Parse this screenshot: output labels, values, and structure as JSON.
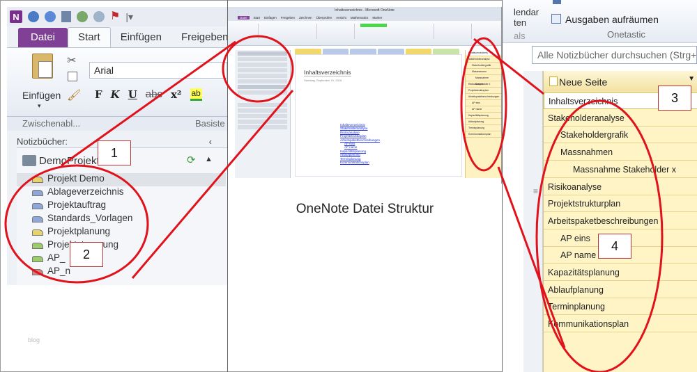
{
  "left": {
    "tabs": [
      "Datei",
      "Start",
      "Einfügen",
      "Freigeben"
    ],
    "font_name": "Arial",
    "paste_label": "Einfügen",
    "group_clipboard": "Zwischenabl...",
    "group_basic": "Basiste",
    "format_buttons": [
      "F",
      "K",
      "U",
      "abc",
      "x²",
      "ab"
    ],
    "notebooks_label": "Notizbücher:",
    "notebook_name": "DemoProjekt",
    "sections": [
      {
        "label": "Projekt Demo",
        "color": "#e8d36a",
        "selected": true
      },
      {
        "label": "Ablageverzeichnis",
        "color": "#8ea7d8",
        "selected": false
      },
      {
        "label": "Projektauftrag",
        "color": "#8ea7d8",
        "selected": false
      },
      {
        "label": "Standards_Vorlagen",
        "color": "#8ea7d8",
        "selected": false
      },
      {
        "label": "Projektplanung",
        "color": "#e8d36a",
        "selected": false
      },
      {
        "label": "Projektsteuerung",
        "color": "#9ccc6a",
        "selected": false
      },
      {
        "label": "AP_",
        "color": "#9ccc6a",
        "selected": false
      },
      {
        "label": "AP_n",
        "color": "#d98080",
        "selected": false
      }
    ]
  },
  "middle": {
    "window_title": "Inhaltsverzeichnis - Microsoft OneNote",
    "ribbon_tabs": [
      "Datei",
      "Start",
      "Einfügen",
      "Freigeben",
      "Zeichnen",
      "Überprüfen",
      "Ansicht",
      "Mathematics",
      "Marker"
    ],
    "page_title": "Inhaltsverzeichnis",
    "page_date": "Samstag, September 10, 2016",
    "page_links": [
      "Inhaltsverzeichnis",
      "Stakeholderanalyse",
      "Risikoanalyse",
      "Projektstrukturplan",
      "Arbeitspaketbeschreibungen",
      "AP eins",
      "AP name",
      "Kapazitätsplanung",
      "Ablaufplanung",
      "Terminplanung",
      "Kommunikationsplan"
    ],
    "caption": "OneNote Datei Struktur"
  },
  "right": {
    "ribbon_labels": [
      "lendar",
      "ten"
    ],
    "ribbon_label_grey": "als",
    "cleanup_button": "Ausgaben aufräumen",
    "group_name": "Onetastic",
    "search_placeholder": "Alle Notizbücher durchsuchen (Strg+E)",
    "new_page": "Neue Seite",
    "pages": [
      {
        "label": "Inhaltsverzeichnis",
        "indent": 0,
        "selected": true
      },
      {
        "label": "Stakeholderanalyse",
        "indent": 0,
        "selected": false
      },
      {
        "label": "Stakeholdergrafik",
        "indent": 1,
        "selected": false
      },
      {
        "label": "Massnahmen",
        "indent": 1,
        "selected": false
      },
      {
        "label": "Massnahme  Stakeholder x",
        "indent": 2,
        "selected": false
      },
      {
        "label": "Risikoanalyse",
        "indent": 0,
        "selected": false
      },
      {
        "label": "Projektstrukturplan",
        "indent": 0,
        "selected": false
      },
      {
        "label": "Arbeitspaketbeschreibungen",
        "indent": 0,
        "selected": false
      },
      {
        "label": "AP eins",
        "indent": 1,
        "selected": false
      },
      {
        "label": "AP name",
        "indent": 1,
        "selected": false
      },
      {
        "label": "Kapazitätsplanung",
        "indent": 0,
        "selected": false
      },
      {
        "label": "Ablaufplanung",
        "indent": 0,
        "selected": false
      },
      {
        "label": "Terminplanung",
        "indent": 0,
        "selected": false
      },
      {
        "label": "Kommunikationsplan",
        "indent": 0,
        "selected": false
      }
    ]
  },
  "annotations": [
    "1",
    "2",
    "3",
    "4"
  ],
  "watermark": "blog",
  "colors": {
    "accent_red": "#e0121b",
    "file_tab": "#7f4096",
    "page_list_bg": "#fff4c6"
  }
}
